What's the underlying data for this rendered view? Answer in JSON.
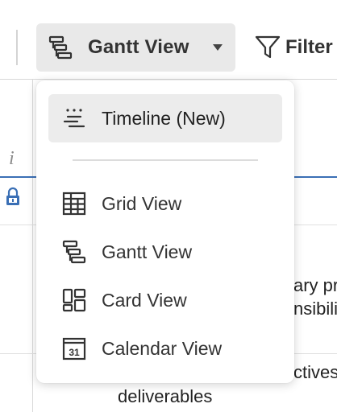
{
  "toolbar": {
    "view_switch_label": "Gantt View",
    "view_switch_icon": "gantt-icon",
    "filter_label": "Filter",
    "filter_icon": "funnel-icon"
  },
  "background": {
    "header_info_glyph": "i",
    "cell_text_1a": "ary pr",
    "cell_text_1b": "nsibili",
    "cell_text_2a": "ctives",
    "cell_text_2b": "deliverables"
  },
  "view_menu": {
    "items": [
      {
        "label": "Timeline (New)",
        "icon": "timeline-icon",
        "selected": true
      },
      {
        "label": "Grid View",
        "icon": "grid-icon",
        "selected": false
      },
      {
        "label": "Gantt View",
        "icon": "gantt-icon",
        "selected": false
      },
      {
        "label": "Card View",
        "icon": "card-icon",
        "selected": false
      },
      {
        "label": "Calendar View",
        "icon": "calendar-icon",
        "selected": false
      }
    ],
    "calendar_icon_day": "31"
  },
  "colors": {
    "accent_blue": "#3a6fb5",
    "selected_bg": "#ececec",
    "switch_bg": "#e9e9e9"
  }
}
